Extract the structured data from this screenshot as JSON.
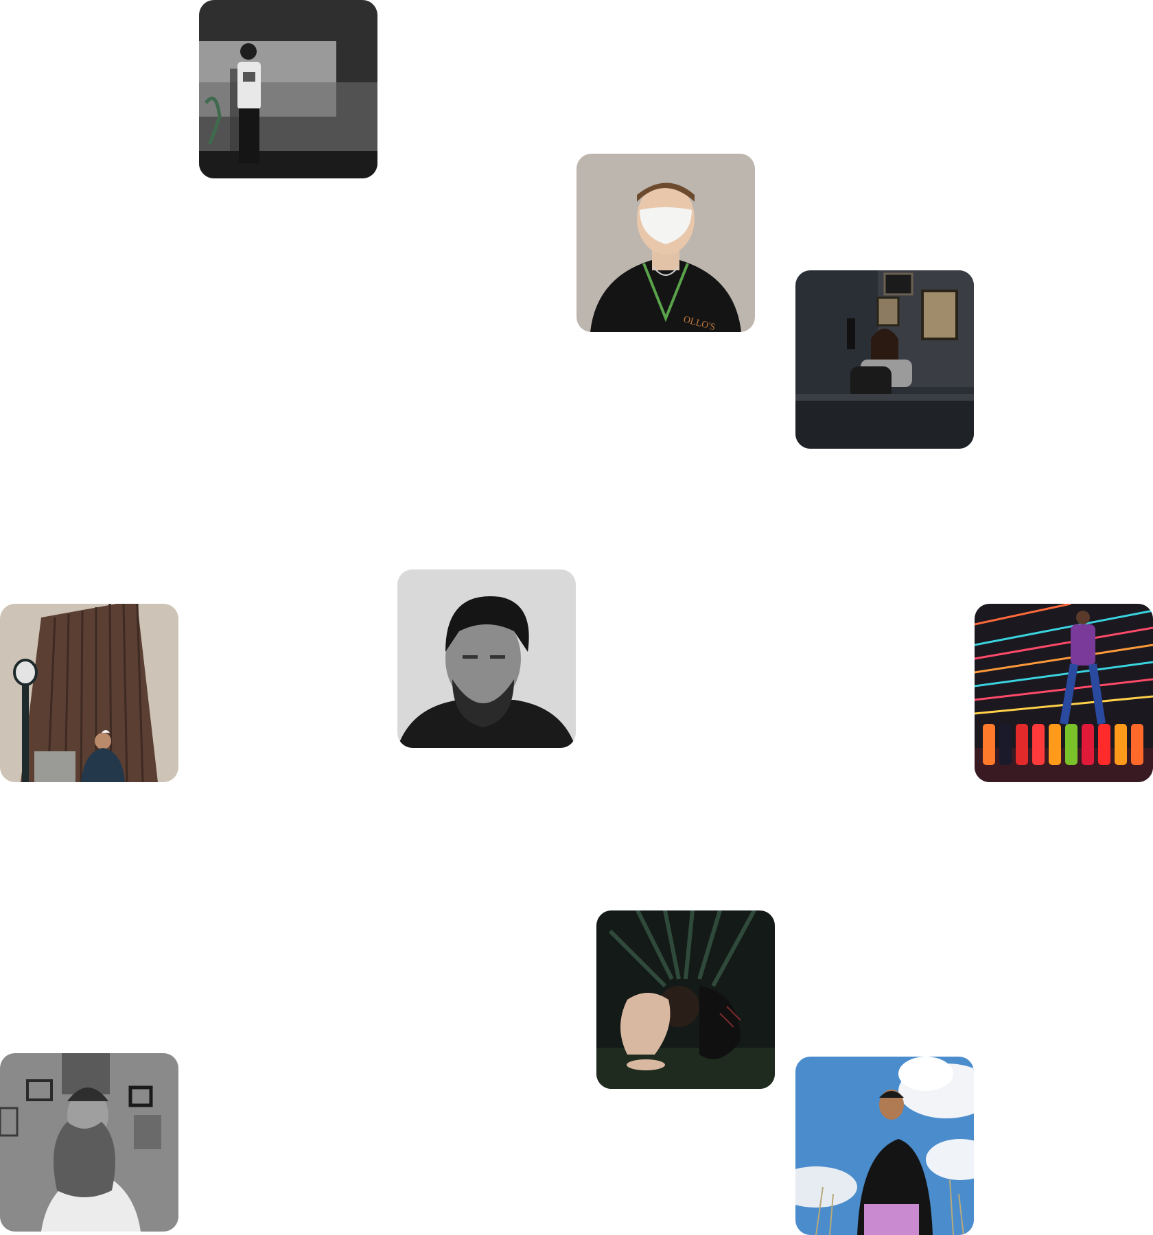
{
  "gallery": {
    "tiles": [
      {
        "icon": "portrait-man-white-tshirt-shadow-wall",
        "tone": "#3a3a3a"
      },
      {
        "icon": "portrait-man-face-mask",
        "tone": "#b9b3ac"
      },
      {
        "icon": "portrait-woman-seated-dark-room",
        "tone": "#2b3038"
      },
      {
        "icon": "portrait-bearded-man-monochrome",
        "tone": "#d8d8d8"
      },
      {
        "icon": "portrait-man-skyscraper-streetlamp",
        "tone": "#6b4a3c"
      },
      {
        "icon": "portrait-person-neon-bottles",
        "tone": "#1f1a24"
      },
      {
        "icon": "portrait-woman-curled-foliage",
        "tone": "#1d2320"
      },
      {
        "icon": "portrait-long-beard-monochrome",
        "tone": "#9c9c9c"
      },
      {
        "icon": "portrait-man-hoodie-sky",
        "tone": "#6fa6d6"
      }
    ]
  }
}
